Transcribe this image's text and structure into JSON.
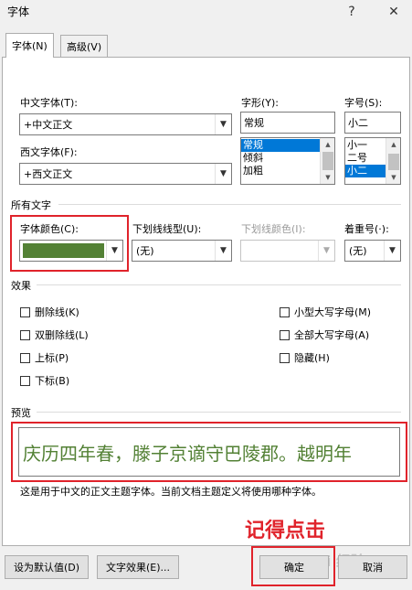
{
  "window": {
    "title": "字体",
    "help": "?",
    "close": "✕"
  },
  "tabs": [
    {
      "label": "字体(N)"
    },
    {
      "label": "高级(V)"
    }
  ],
  "font": {
    "chinese_label": "中文字体(T):",
    "chinese_value": "+中文正文",
    "western_label": "西文字体(F):",
    "western_value": "+西文正文",
    "style_label": "字形(Y):",
    "style_value": "常规",
    "style_options": [
      "常规",
      "倾斜",
      "加粗"
    ],
    "style_selected": 0,
    "size_label": "字号(S):",
    "size_value": "小二",
    "size_options": [
      "小一",
      "二号",
      "小二"
    ],
    "size_selected": 2
  },
  "all_text": {
    "section_label": "所有文字",
    "color_label": "字体颜色(C):",
    "color_value": "#538135",
    "underline_label": "下划线线型(U):",
    "underline_value": "(无)",
    "underline_color_label": "下划线颜色(I):",
    "emphasis_label": "着重号(·):",
    "emphasis_value": "(无)"
  },
  "effects": {
    "section_label": "效果",
    "left": [
      "删除线(K)",
      "双删除线(L)",
      "上标(P)",
      "下标(B)"
    ],
    "right": [
      "小型大写字母(M)",
      "全部大写字母(A)",
      "隐藏(H)"
    ]
  },
  "preview": {
    "section_label": "预览",
    "sample_text": "庆历四年春，滕子京谪守巴陵郡。越明年",
    "note": "这是用于中文的正文主题字体。当前文档主题定义将使用哪种字体。"
  },
  "buttons": {
    "set_default": "设为默认值(D)",
    "text_effects": "文字效果(E)...",
    "ok": "确定",
    "cancel": "取消"
  },
  "annotation": {
    "text": "记得点击"
  },
  "watermark": {
    "text": "Bai 经验"
  }
}
